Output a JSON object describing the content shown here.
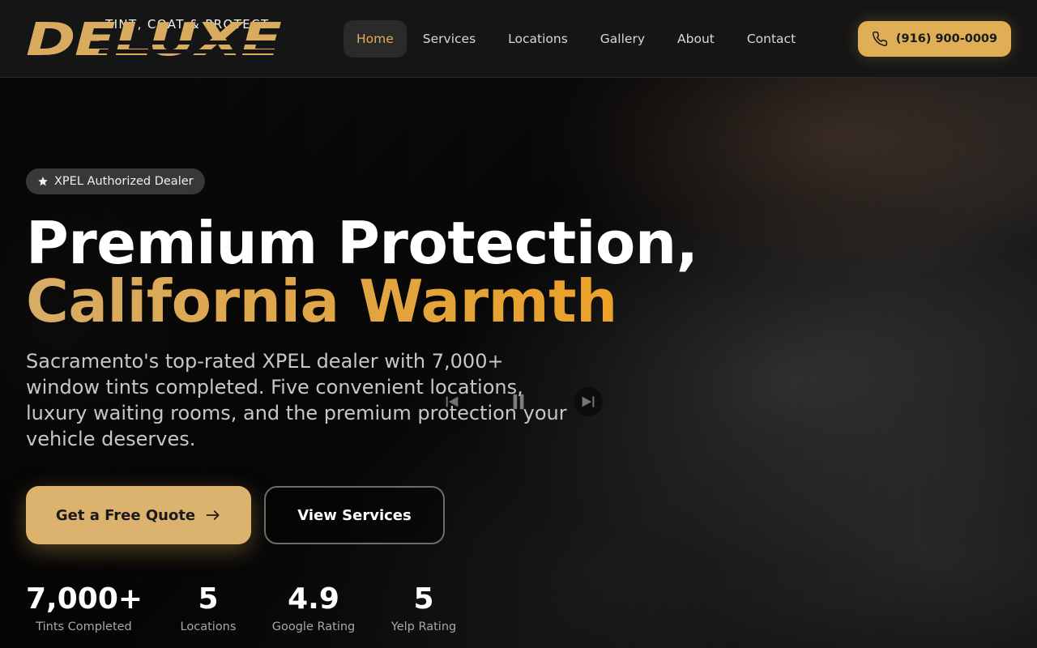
{
  "brand": {
    "tagline": "TINT, COAT & PROTECT",
    "wordmark": "DELUXE",
    "accent_color": "#dfae55"
  },
  "nav": {
    "items": [
      {
        "label": "Home",
        "active": true
      },
      {
        "label": "Services",
        "active": false
      },
      {
        "label": "Locations",
        "active": false
      },
      {
        "label": "Gallery",
        "active": false
      },
      {
        "label": "About",
        "active": false
      },
      {
        "label": "Contact",
        "active": false
      }
    ],
    "phone": {
      "label": "(916) 900-0009",
      "icon": "phone-icon"
    }
  },
  "hero": {
    "badge": {
      "label": "XPEL Authorized Dealer",
      "icon": "star-icon"
    },
    "headline": {
      "line1": "Premium Protection,",
      "line2": "California Warmth"
    },
    "subtitle": "Sacramento's top-rated XPEL dealer with 7,000+ window tints completed. Five convenient locations, luxury waiting rooms, and the premium protection your vehicle deserves.",
    "primary_cta": {
      "label": "Get a Free Quote",
      "icon": "arrow-right-icon"
    },
    "secondary_cta": {
      "label": "View Services"
    },
    "video_controls": {
      "prev_icon": "skip-back-icon",
      "pause_icon": "pause-icon",
      "next_icon": "skip-forward-icon"
    },
    "stats": [
      {
        "value": "7,000+",
        "label": "Tints Completed"
      },
      {
        "value": "5",
        "label": "Locations"
      },
      {
        "value": "4.9",
        "label": "Google Rating"
      },
      {
        "value": "5",
        "label": "Yelp Rating"
      }
    ]
  }
}
